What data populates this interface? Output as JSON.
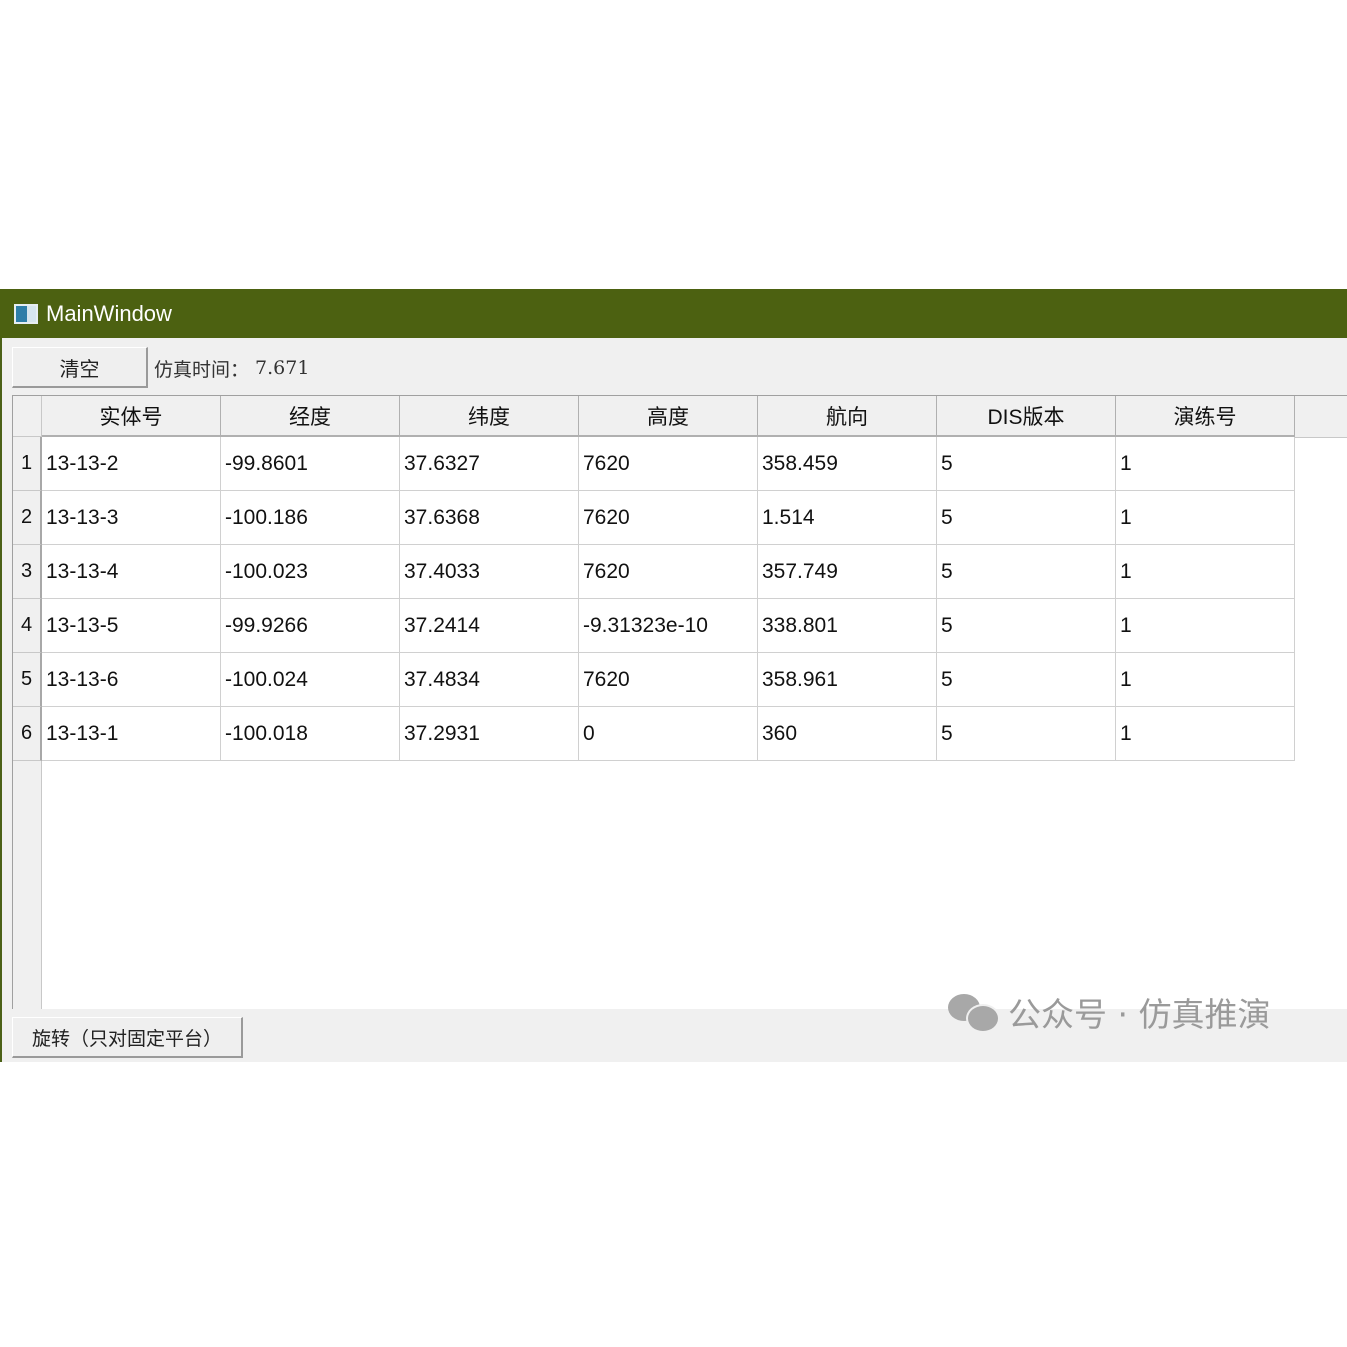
{
  "window": {
    "title": "MainWindow"
  },
  "toolbar": {
    "clear_label": "清空",
    "sim_time_label": "仿真时间：",
    "sim_time_value": "7.671"
  },
  "table": {
    "columns": [
      "实体号",
      "经度",
      "纬度",
      "高度",
      "航向",
      "DIS版本",
      "演练号"
    ],
    "rows": [
      {
        "num": "1",
        "cells": [
          "13-13-2",
          "-99.8601",
          "37.6327",
          "7620",
          "358.459",
          "5",
          "1"
        ]
      },
      {
        "num": "2",
        "cells": [
          "13-13-3",
          "-100.186",
          "37.6368",
          "7620",
          "1.514",
          "5",
          "1"
        ]
      },
      {
        "num": "3",
        "cells": [
          "13-13-4",
          "-100.023",
          "37.4033",
          "7620",
          "357.749",
          "5",
          "1"
        ]
      },
      {
        "num": "4",
        "cells": [
          "13-13-5",
          "-99.9266",
          "37.2414",
          "-9.31323e-10",
          "338.801",
          "5",
          "1"
        ]
      },
      {
        "num": "5",
        "cells": [
          "13-13-6",
          "-100.024",
          "37.4834",
          "7620",
          "358.961",
          "5",
          "1"
        ]
      },
      {
        "num": "6",
        "cells": [
          "13-13-1",
          "-100.018",
          "37.2931",
          "0",
          "360",
          "5",
          "1"
        ]
      }
    ]
  },
  "bottom": {
    "rotate_label": "旋转（只对固定平台）"
  },
  "watermark": {
    "text": "公众号 · 仿真推演",
    "icon": "wechat-icon"
  },
  "colors": {
    "titlebar": "#4c6111",
    "window_bg": "#f0f0f0"
  }
}
